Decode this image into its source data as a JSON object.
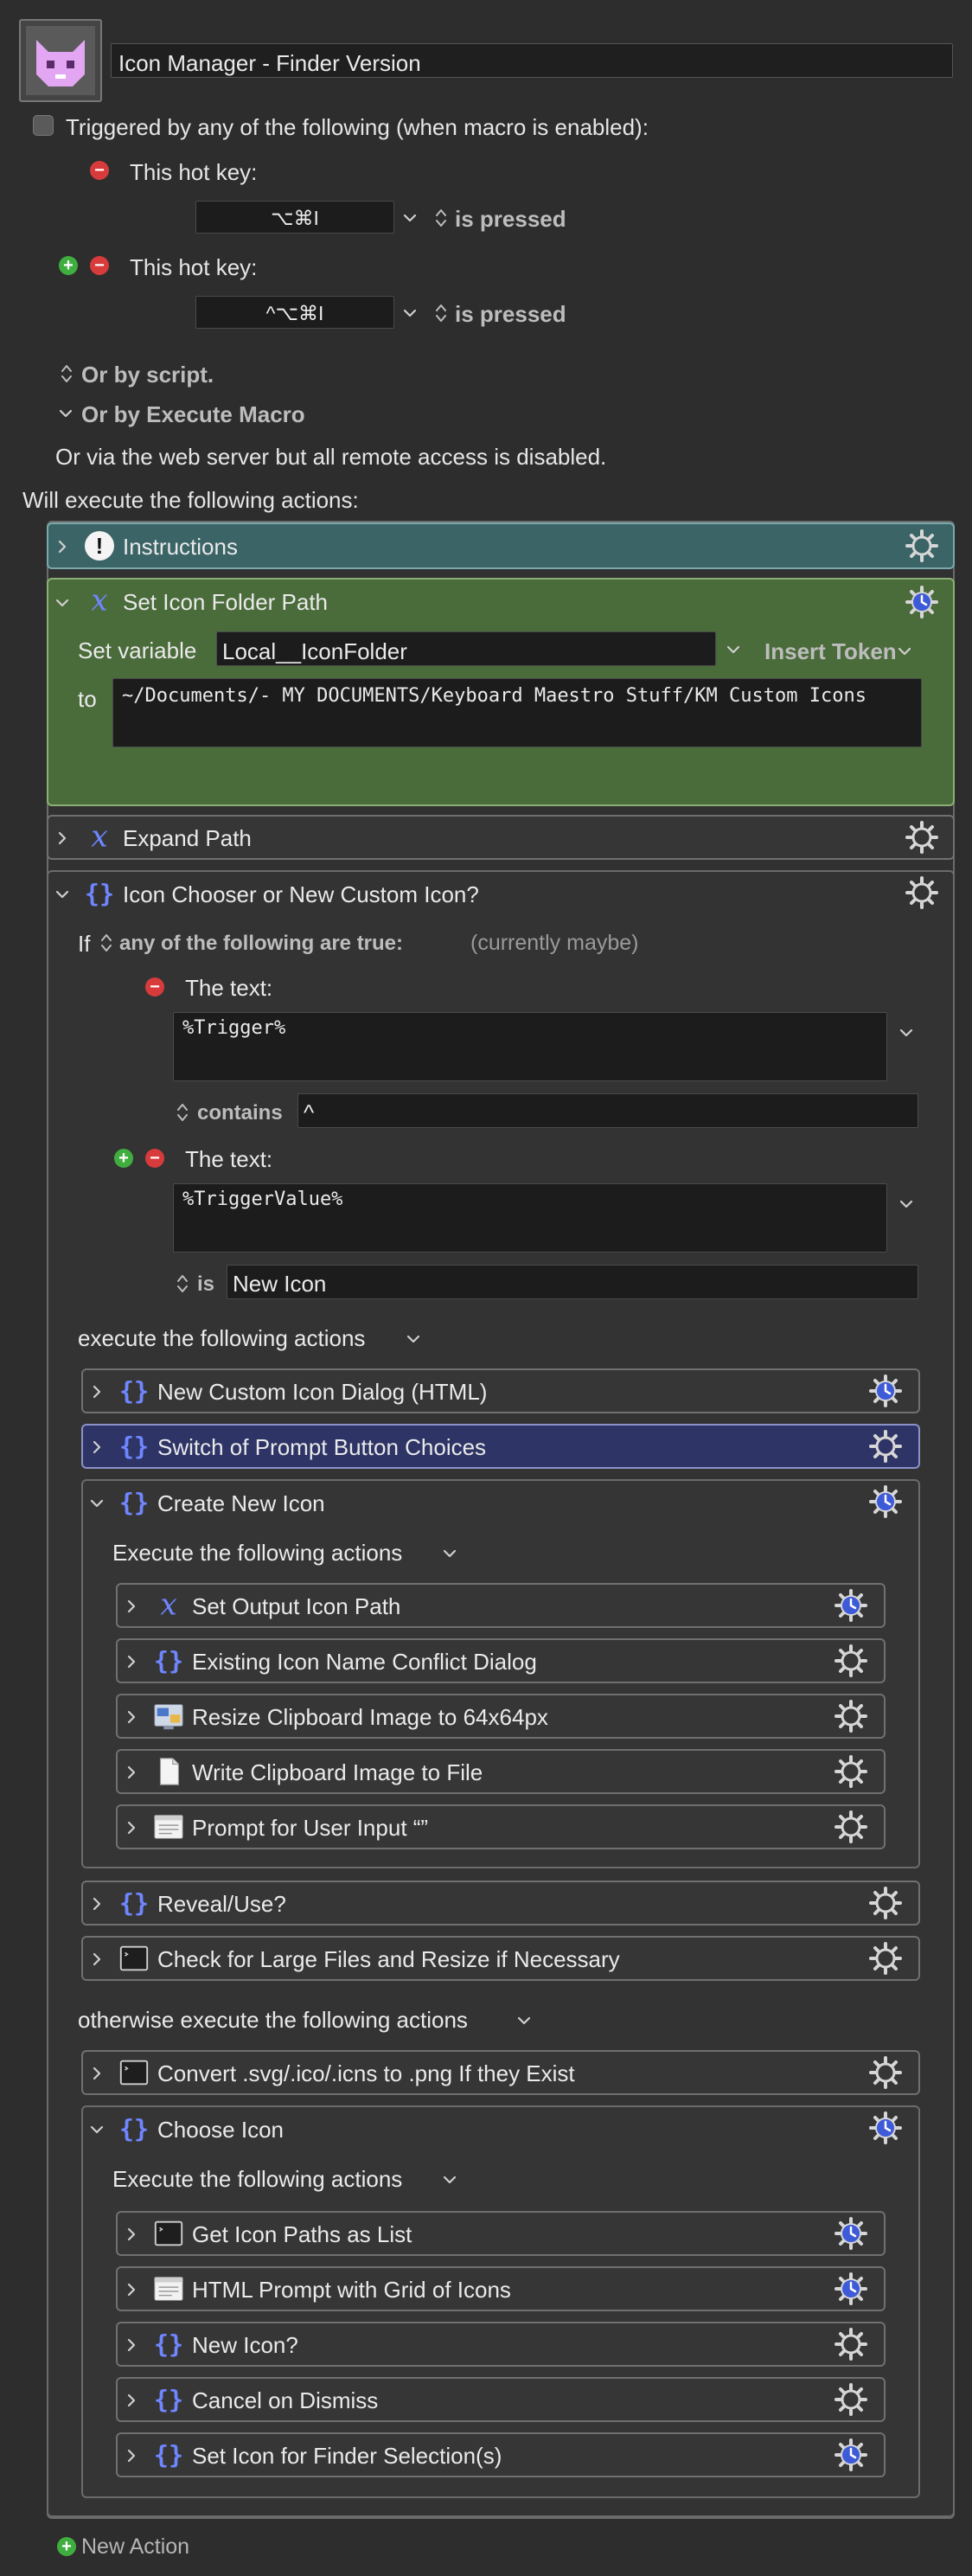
{
  "macro": {
    "name": "Icon Manager  - Finder Version"
  },
  "trigger": {
    "header": "Triggered by any of the following (when macro is enabled):",
    "hotkeys": [
      {
        "label": "This hot key:",
        "keys": "⌥⌘I",
        "state": "is pressed"
      },
      {
        "label": "This hot key:",
        "keys": "^⌥⌘I",
        "state": "is pressed"
      }
    ],
    "or_script": "Or by script.",
    "or_execute": "Or by Execute Macro",
    "web_note": "Or via the web server but all remote access is disabled."
  },
  "actions_header": "Will execute the following actions:",
  "actions": {
    "instructions": "Instructions",
    "set_icon_folder": {
      "title": "Set Icon Folder Path",
      "set_variable_label": "Set variable",
      "variable": "Local__IconFolder",
      "insert_token": "Insert Token",
      "to_label": "to",
      "value": "~/Documents/- MY DOCUMENTS/Keyboard Maestro Stuff/KM Custom Icons"
    },
    "expand_path": "Expand Path",
    "chooser": {
      "title": "Icon Chooser or New Custom Icon?",
      "if_label": "If",
      "condition_mode": "any of the following are true:",
      "status": "(currently maybe)",
      "cond1": {
        "label": "The text:",
        "value": "%Trigger%",
        "op": "contains",
        "operand": "^"
      },
      "cond2": {
        "label": "The text:",
        "value": "%TriggerValue%",
        "op": "is",
        "operand": "New Icon"
      },
      "then_label": "execute the following actions",
      "then_items": {
        "new_dialog": "New Custom Icon Dialog (HTML)",
        "switch_prompt": "Switch of Prompt Button Choices",
        "create_new": "Create New Icon",
        "create_exec_label": "Execute the following actions",
        "create_items": [
          "Set Output Icon Path",
          "Existing Icon Name Conflict Dialog",
          "Resize Clipboard Image to 64x64px",
          "Write Clipboard Image to File",
          "Prompt for User Input “”"
        ],
        "reveal": "Reveal/Use?",
        "check_large": "Check for Large Files and Resize if Necessary"
      },
      "else_label": "otherwise execute the following actions",
      "else_items": {
        "convert": "Convert .svg/.ico/.icns to .png If they Exist",
        "choose": "Choose Icon",
        "choose_exec_label": "Execute the following actions",
        "choose_items": [
          "Get Icon Paths as List",
          "HTML Prompt with Grid of Icons",
          "New Icon?",
          "Cancel on Dismiss",
          "Set Icon for Finder Selection(s)"
        ]
      }
    }
  },
  "new_action": "New Action",
  "colors": {
    "instructions_bg": "#3b6466",
    "set_path_bg": "#4a6b3a",
    "switch_bg": "#2e3466",
    "accent_blue": "#5a6fe0"
  }
}
